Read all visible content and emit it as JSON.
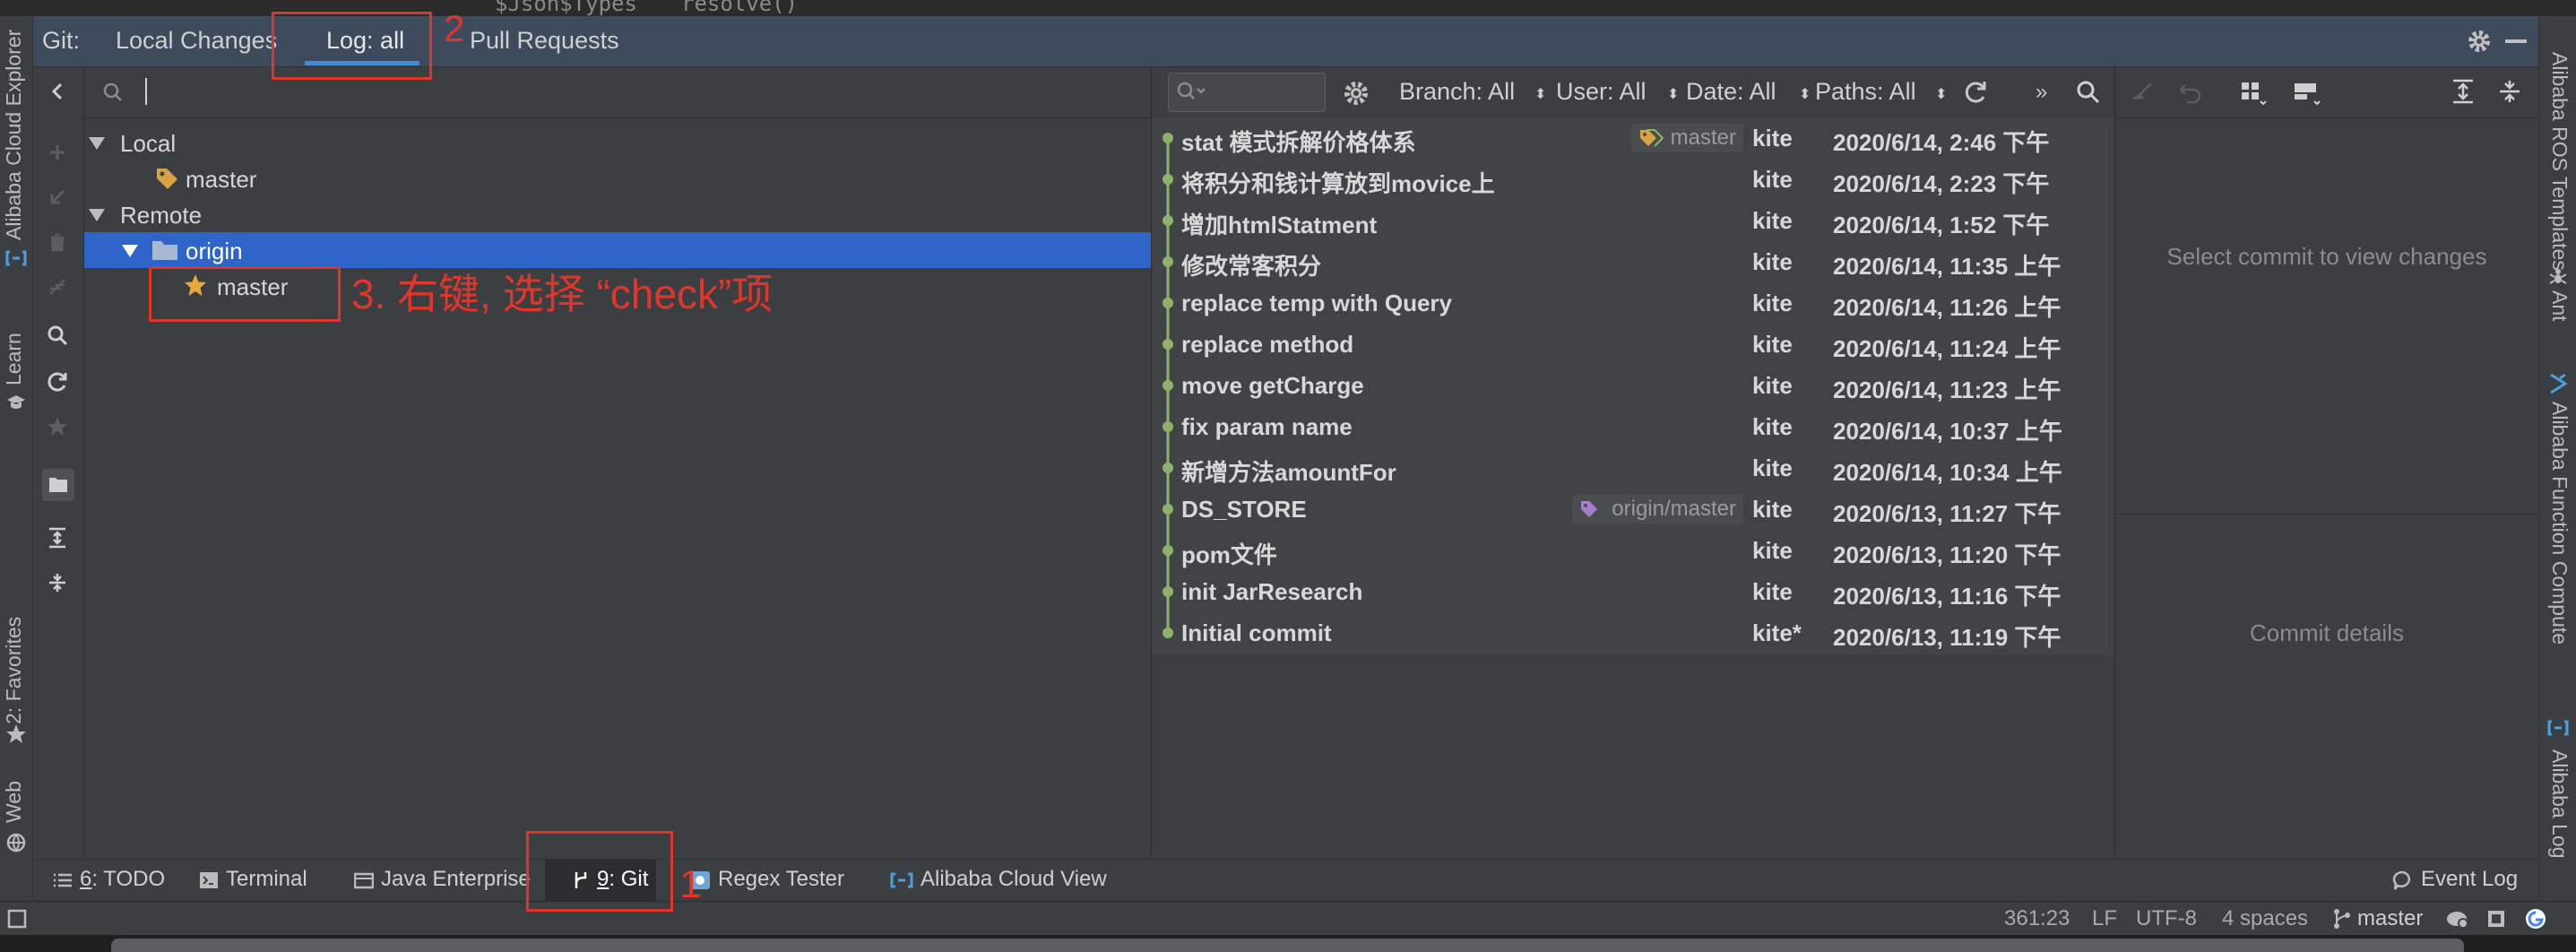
{
  "editor_strip": {
    "left_text": "$Json$Types",
    "right_text": "resolve()"
  },
  "left_sidebar": {
    "alibaba_cloud_explorer": "Alibaba Cloud Explorer",
    "learn": "Learn",
    "favorites": "2: Favorites",
    "web": "Web"
  },
  "right_sidebar": {
    "ros_templates": "Alibaba ROS Templates",
    "ant": "Ant",
    "function_compute": "Alibaba Function Compute",
    "log": "Alibaba Log"
  },
  "git_panel": {
    "prefix": "Git:",
    "tabs": [
      {
        "label": "Local Changes"
      },
      {
        "label": "Log: all"
      },
      {
        "label": "Pull Requests"
      }
    ]
  },
  "branches": {
    "local_label": "Local",
    "local_master": "master",
    "remote_label": "Remote",
    "origin_label": "origin",
    "origin_master": "master"
  },
  "log_filters": {
    "branch": "Branch: All",
    "user": "User: All",
    "date": "Date: All",
    "paths": "Paths: All"
  },
  "commits": [
    {
      "message": "stat 模式拆解价格体系",
      "author": "kite",
      "date": "2020/6/14, 2:46 下午",
      "ref": "master"
    },
    {
      "message": "将积分和钱计算放到movice上",
      "author": "kite",
      "date": "2020/6/14, 2:23 下午"
    },
    {
      "message": "增加htmlStatment",
      "author": "kite",
      "date": "2020/6/14, 1:52 下午"
    },
    {
      "message": "修改常客积分",
      "author": "kite",
      "date": "2020/6/14, 11:35 上午"
    },
    {
      "message": "replace temp with Query",
      "author": "kite",
      "date": "2020/6/14, 11:26 上午"
    },
    {
      "message": "replace method",
      "author": "kite",
      "date": "2020/6/14, 11:24 上午"
    },
    {
      "message": "move getCharge",
      "author": "kite",
      "date": "2020/6/14, 11:23 上午"
    },
    {
      "message": "fix param name",
      "author": "kite",
      "date": "2020/6/14, 10:37 上午"
    },
    {
      "message": "新增方法amountFor",
      "author": "kite",
      "date": "2020/6/14, 10:34 上午"
    },
    {
      "message": "DS_STORE",
      "author": "kite",
      "date": "2020/6/13, 11:27 下午",
      "ref": "origin/master"
    },
    {
      "message": "pom文件",
      "author": "kite",
      "date": "2020/6/13, 11:20 下午"
    },
    {
      "message": "init JarResearch",
      "author": "kite",
      "date": "2020/6/13, 11:16 下午"
    },
    {
      "message": "Initial commit",
      "author": "kite*",
      "date": "2020/6/13, 11:19 下午"
    }
  ],
  "details": {
    "select_commit": "Select commit to view changes",
    "commit_details": "Commit details"
  },
  "bottom_tabs": {
    "todo_num": "6",
    "todo": ": TODO",
    "terminal": "Terminal",
    "java_enterprise": "Java Enterprise",
    "git_num": "9",
    "git": ": Git",
    "regex_tester": "Regex Tester",
    "alibaba_cloud_view": "Alibaba Cloud View",
    "event_log": "Event Log"
  },
  "status": {
    "position": "361:23",
    "line_sep": "LF",
    "encoding": "UTF-8",
    "indent": "4 spaces",
    "branch": "master"
  },
  "annotations": {
    "step1": "1",
    "step2": "2",
    "step3": "3. 右键, 选择 “check”项"
  },
  "colors": {
    "accent_blue": "#4a88c7",
    "selection_blue": "#2f65ca",
    "graph_green": "#8fb26a",
    "annotation_red": "#e0352b",
    "tag_yellow": "#d9a343",
    "tag_purple": "#a57fcf"
  }
}
